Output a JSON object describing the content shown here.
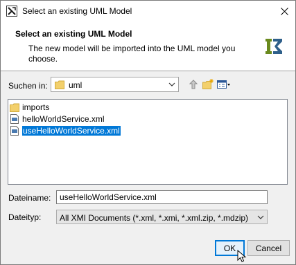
{
  "window": {
    "title": "Select an existing UML Model",
    "close_icon": "close-icon"
  },
  "header": {
    "title": "Select an existing UML Model",
    "description": "The new model will be imported into the UML model you choose.",
    "logo_icon": "uml-logo-icon"
  },
  "lookin": {
    "label": "Suchen in:",
    "value": "uml"
  },
  "toolbar": {
    "up_icon": "up-folder-icon",
    "new_folder_icon": "new-folder-icon",
    "view_menu_icon": "view-menu-icon"
  },
  "files": [
    {
      "name": "imports",
      "type": "folder",
      "selected": false
    },
    {
      "name": "helloWorldService.xml",
      "type": "file",
      "selected": false
    },
    {
      "name": "useHelloWorldService.xml",
      "type": "file",
      "selected": true
    }
  ],
  "filename": {
    "label": "Dateiname:",
    "value": "useHelloWorldService.xml"
  },
  "filetype": {
    "label": "Dateityp:",
    "value": "All XMI Documents (*.xml, *.xmi, *.xml.zip, *.mdzip)"
  },
  "buttons": {
    "ok": "OK",
    "cancel": "Cancel"
  },
  "colors": {
    "selection": "#0078d7",
    "folder": "#f3d06b",
    "logo_green": "#6a8a1e",
    "logo_blue": "#2e5f8a"
  }
}
